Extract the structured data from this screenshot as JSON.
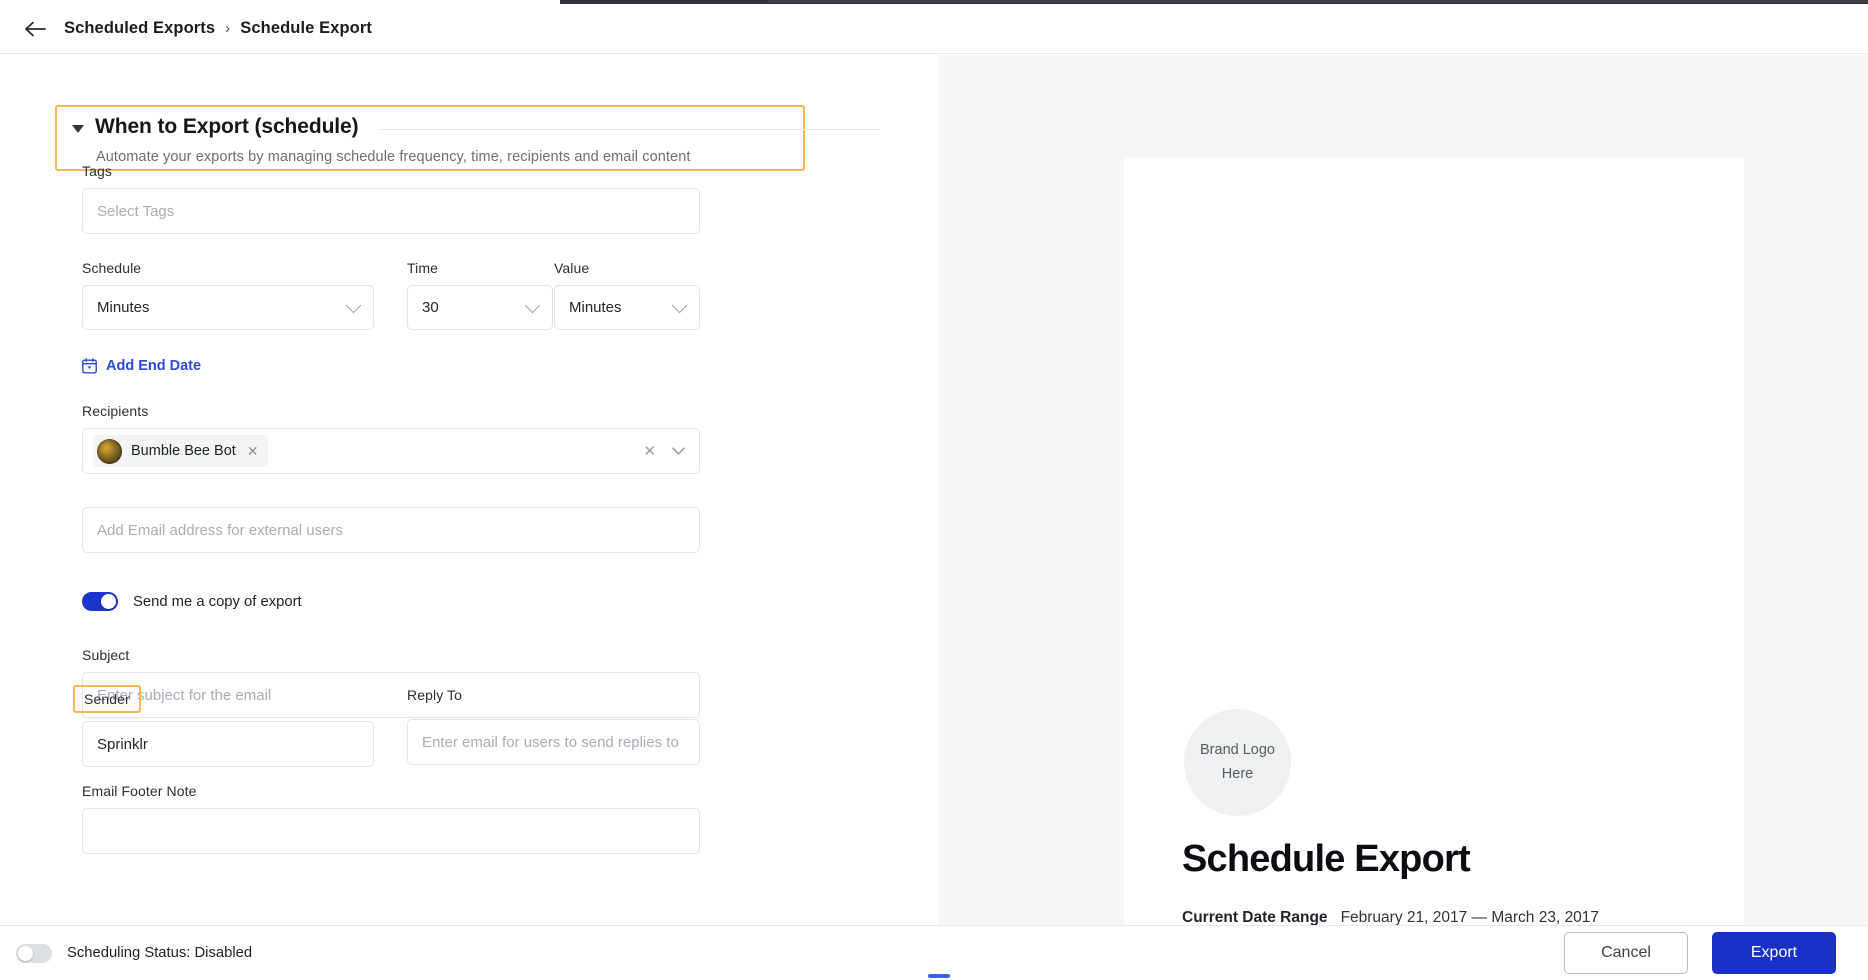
{
  "breadcrumb": {
    "back_icon": "back-arrow-icon",
    "root": "Scheduled Exports",
    "separator": "›",
    "leaf": "Schedule Export"
  },
  "section": {
    "title": "When to Export (schedule)",
    "subtitle": "Automate your exports by managing schedule frequency, time, recipients and email content",
    "collapse_icon": "caret-down-icon",
    "highlight_color": "#f7b94c"
  },
  "form": {
    "tags": {
      "label": "Tags",
      "value": "",
      "placeholder": "Select Tags"
    },
    "schedule": {
      "label": "Schedule",
      "value": "Minutes"
    },
    "time": {
      "label": "Time",
      "value": "30"
    },
    "value": {
      "label": "Value",
      "value": "Minutes"
    },
    "add_end_date": {
      "label": "Add End Date",
      "icon": "calendar-icon"
    },
    "recipients": {
      "label": "Recipients",
      "chips": [
        {
          "name": "Bumble Bee Bot",
          "avatar": "bee-avatar"
        }
      ],
      "clear_icon": "close-icon",
      "dropdown_icon": "chevron-down-icon"
    },
    "external_email": {
      "value": "",
      "placeholder": "Add Email address for external users"
    },
    "send_copy": {
      "label": "Send me a copy of export",
      "state": "on"
    },
    "subject": {
      "label": "Subject",
      "value": "",
      "placeholder": "Enter subject for the email"
    },
    "sender": {
      "label": "Sender",
      "value": "Sprinklr",
      "highlighted": true
    },
    "reply_to": {
      "label": "Reply To",
      "value": "",
      "placeholder": "Enter email for users to send replies to"
    },
    "email_footer_note": {
      "label": "Email Footer Note",
      "value": ""
    }
  },
  "preview": {
    "brand_logo_line1": "Brand Logo",
    "brand_logo_line2": "Here",
    "title": "Schedule Export",
    "date_range_label": "Current Date Range",
    "date_range_value": "February 21, 2017 — March 23, 2017"
  },
  "footer": {
    "scheduling_status": {
      "label": "Scheduling Status: Disabled",
      "state": "off"
    },
    "cancel_label": "Cancel",
    "export_label": "Export",
    "accent_color": "#1b31c6"
  }
}
